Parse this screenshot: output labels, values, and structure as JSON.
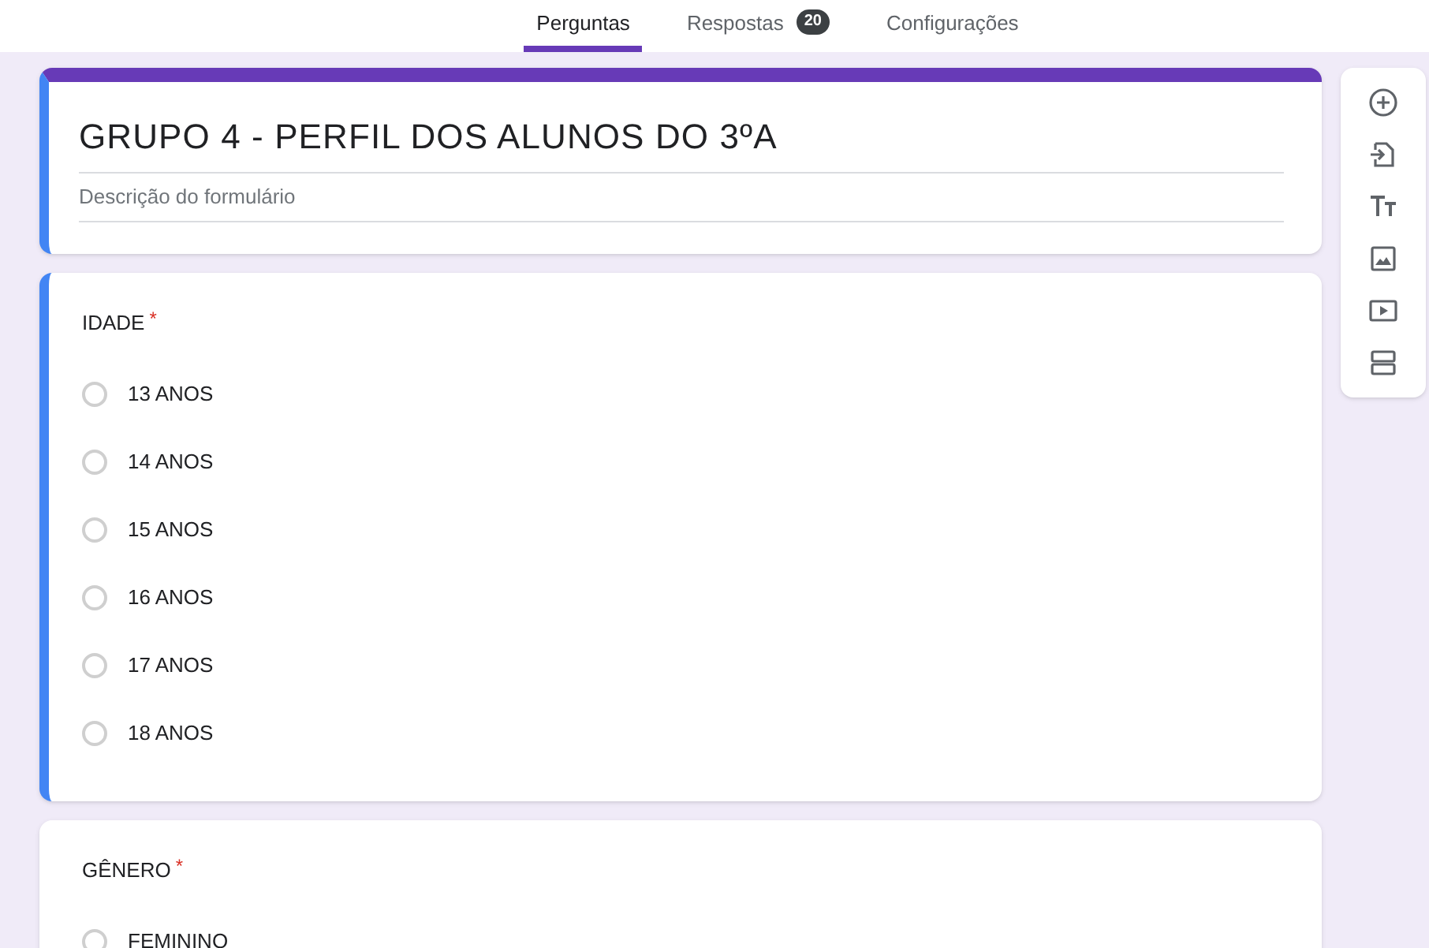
{
  "tabs": [
    {
      "label": "Perguntas",
      "selected": true
    },
    {
      "label": "Respostas",
      "selected": false,
      "badge": "20"
    },
    {
      "label": "Configurações",
      "selected": false
    }
  ],
  "form": {
    "title": "GRUPO 4 - PERFIL DOS ALUNOS DO 3ºA",
    "description": {
      "placeholder": "Descrição do formulário"
    }
  },
  "questions": [
    {
      "title": "IDADE",
      "required_mark": "*",
      "focused": true,
      "options": [
        {
          "label": "13 ANOS"
        },
        {
          "label": "14 ANOS"
        },
        {
          "label": "15 ANOS"
        },
        {
          "label": "16 ANOS"
        },
        {
          "label": "17 ANOS"
        },
        {
          "label": "18 ANOS"
        }
      ]
    },
    {
      "title": "GÊNERO",
      "required_mark": "*",
      "focused": false,
      "options": [
        {
          "label": "FEMININO"
        }
      ]
    }
  ],
  "toolbar": [
    {
      "kind": "add"
    },
    {
      "kind": "import"
    },
    {
      "kind": "title"
    },
    {
      "kind": "image"
    },
    {
      "kind": "video"
    },
    {
      "kind": "section"
    }
  ]
}
